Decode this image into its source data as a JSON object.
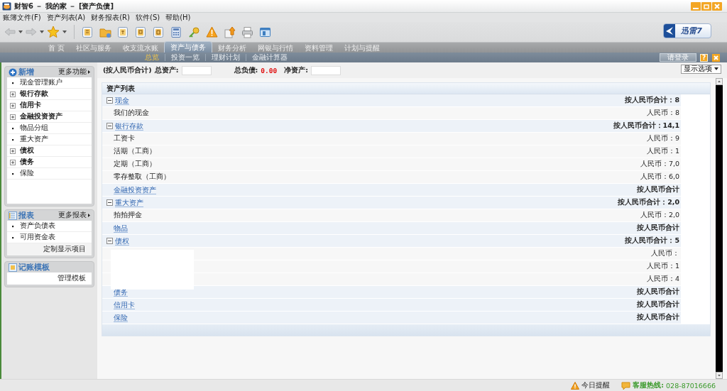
{
  "window": {
    "title": "财智6 － 我的家 － [资产负债]"
  },
  "menu": [
    "账簿文件(F)",
    "资产列表(A)",
    "财务报表(R)",
    "软件(S)",
    "帮助(H)"
  ],
  "ad_logo": {
    "text": "迅雷7"
  },
  "main_tabs": [
    {
      "label": "首 页",
      "selected": false
    },
    {
      "label": "社区与服务",
      "selected": false
    },
    {
      "label": "收支流水账",
      "selected": false
    },
    {
      "label": "资产与债务",
      "selected": true
    },
    {
      "label": "财务分析",
      "selected": false
    },
    {
      "label": "网银与行情",
      "selected": false
    },
    {
      "label": "资料管理",
      "selected": false
    },
    {
      "label": "计划与提醒",
      "selected": false
    }
  ],
  "sub_tabs": [
    {
      "label": "总览",
      "selected": true
    },
    {
      "label": "投资一览",
      "selected": false
    },
    {
      "label": "理财计划",
      "selected": false
    },
    {
      "label": "金融计算器",
      "selected": false
    }
  ],
  "login_button": "请登录",
  "help_button": "?",
  "summary": {
    "prefix": "(按人民币合计)",
    "total_assets_label": "总资产:",
    "total_liabilities_label": "总负债:",
    "total_liabilities": "0.00",
    "net_assets_label": "净资产:"
  },
  "display_options": "显示选项",
  "sidebar": [
    {
      "kind": "add",
      "title": "新增",
      "more": "更多功能",
      "items": [
        {
          "label": "现金管理账户",
          "kind": "leaf"
        },
        {
          "label": "银行存款",
          "kind": "expandable"
        },
        {
          "label": "信用卡",
          "kind": "expandable"
        },
        {
          "label": "金融投资资产",
          "kind": "expandable"
        },
        {
          "label": "物品分组",
          "kind": "leaf"
        },
        {
          "label": "重大资产",
          "kind": "leaf"
        },
        {
          "label": "债权",
          "kind": "expandable"
        },
        {
          "label": "债务",
          "kind": "expandable"
        },
        {
          "label": "保险",
          "kind": "leaf"
        }
      ]
    },
    {
      "kind": "report",
      "title": "报表",
      "more": "更多报表",
      "items": [
        {
          "label": "资产负债表",
          "kind": "leaf"
        },
        {
          "label": "可用资金表",
          "kind": "leaf"
        }
      ],
      "footer": "定制显示项目"
    },
    {
      "kind": "template",
      "title": "记账模板",
      "footer": "管理模板"
    }
  ],
  "asset_list": {
    "title": "资产列表",
    "rows": [
      {
        "kind": "group",
        "name": "现金",
        "expanded": true,
        "total": "按人民币合计：8"
      },
      {
        "kind": "item",
        "name": "我们的现金",
        "total": "人民币：8"
      },
      {
        "kind": "group",
        "name": "银行存款",
        "expanded": true,
        "total": "按人民币合计：14,1"
      },
      {
        "kind": "item",
        "name": "工资卡",
        "total": "人民币：9"
      },
      {
        "kind": "item",
        "name": "活期（工商）",
        "total": "人民币：1"
      },
      {
        "kind": "item",
        "name": "定期（工商）",
        "total": "人民币：7,0"
      },
      {
        "kind": "item",
        "name": "零存整取（工商）",
        "total": "人民币：6,0"
      },
      {
        "kind": "empty-group",
        "name": "金融投资资产",
        "total": "按人民币合计"
      },
      {
        "kind": "group",
        "name": "重大资产",
        "expanded": true,
        "total": "按人民币合计：2,0"
      },
      {
        "kind": "item",
        "name": "拍拍押金",
        "total": "人民币：2,0"
      },
      {
        "kind": "empty-group",
        "name": "物品",
        "total": "按人民币合计"
      },
      {
        "kind": "group",
        "name": "债权",
        "expanded": true,
        "total": "按人民币合计：5"
      },
      {
        "kind": "masked",
        "totals": [
          "人民币：",
          "人民币：1",
          "人民币：4"
        ]
      },
      {
        "kind": "empty-group",
        "name": "债务",
        "total": "按人民币合计"
      },
      {
        "kind": "empty-group",
        "name": "信用卡",
        "total": "按人民币合计"
      },
      {
        "kind": "empty-group",
        "name": "保险",
        "total": "按人民币合计"
      }
    ]
  },
  "status_bar": {
    "reminder": "今日提醒",
    "hotline_label": "客服热线:",
    "hotline": "028-87016666"
  }
}
